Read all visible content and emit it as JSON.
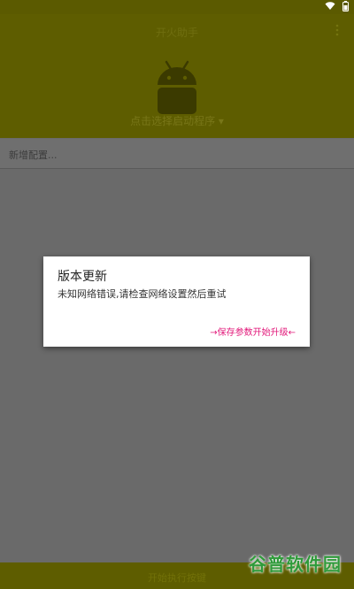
{
  "app": {
    "title": "开火助手",
    "subtitle": "点击选择启动程序 ▾",
    "config_label": "新增配置..."
  },
  "dialog": {
    "title": "版本更新",
    "message": "未知网络错误,请检查网络设置然后重试",
    "button_label": "→保存参数开始升级←"
  },
  "bottom": {
    "label": "开始执行按键"
  },
  "watermark": {
    "text": "谷普软件园"
  },
  "colors": {
    "accent": "#e2187a",
    "appbar": "#5e5d00",
    "scrim": "#6a6a6a"
  },
  "icons": [
    "wifi-icon",
    "battery-icon",
    "overflow-menu-icon",
    "android-robot-icon"
  ]
}
